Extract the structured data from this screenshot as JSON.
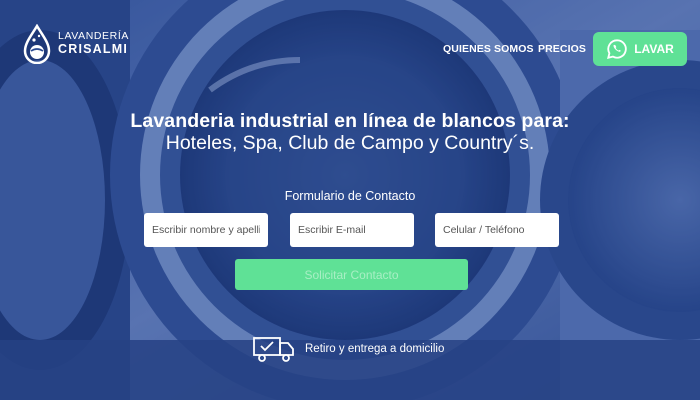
{
  "brand": {
    "line1": "LAVANDERÍA",
    "line2": "CRISALMI"
  },
  "nav": {
    "quienes": "QUIENES SOMOS",
    "precios": "PRECIOS"
  },
  "cta": {
    "label": "LAVAR",
    "icon": "whatsapp-icon",
    "color": "#5fe196"
  },
  "hero": {
    "headline": "Lavanderia industrial en línea de blancos para:",
    "subheadline": "Hoteles, Spa, Club de Campo y Country´s."
  },
  "form": {
    "title": "Formulario de Contacto",
    "name_placeholder": "Escribir nombre y apellido",
    "email_placeholder": "Escribir E-mail",
    "phone_placeholder": "Celular / Teléfono",
    "submit_label": "Solicitar Contacto"
  },
  "delivery": {
    "text": "Retiro y entrega a domicilio",
    "icon": "truck-icon"
  },
  "colors": {
    "accent": "#5fe196",
    "overlay": "#2b4a8f"
  }
}
